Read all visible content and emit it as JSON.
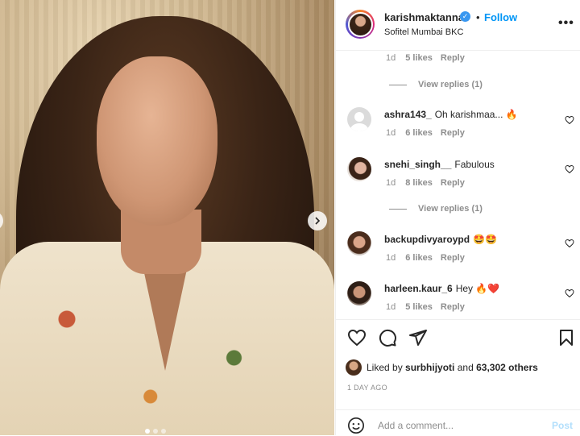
{
  "post": {
    "username": "karishmaktanna",
    "location": "Sofitel Mumbai BKC",
    "follow_label": "Follow",
    "dot_separator": "•",
    "more_label": "•••",
    "verified_mark": "✓"
  },
  "comments": {
    "top": {
      "time": "1d",
      "likes": "5 likes",
      "reply": "Reply"
    },
    "view_replies_1": "View replies (1)",
    "items": [
      {
        "username": "ashra143_",
        "text": "Oh karishmaa... 🔥",
        "time": "1d",
        "likes": "6 likes",
        "reply": "Reply"
      },
      {
        "username": "snehi_singh__",
        "text": "Fabulous",
        "time": "1d",
        "likes": "8 likes",
        "reply": "Reply"
      },
      {
        "username": "backupdivyaroypd",
        "text": "🤩🤩",
        "time": "1d",
        "likes": "6 likes",
        "reply": "Reply"
      },
      {
        "username": "harleen.kaur_6",
        "text": "Hey 🔥❤️",
        "time": "1d",
        "likes": "5 likes",
        "reply": "Reply"
      }
    ],
    "view_replies_2": "View replies (1)"
  },
  "likes": {
    "prefix": "Liked by",
    "user": "surbhijyoti",
    "middle": "and",
    "count": "63,302 others"
  },
  "time_ago": "1 DAY AGO",
  "comment_box": {
    "placeholder": "Add a comment...",
    "post_label": "Post"
  },
  "icons": [
    "heart-icon",
    "comment-icon",
    "share-icon",
    "bookmark-icon",
    "emoji-icon",
    "verified-icon",
    "chevron-right-icon"
  ],
  "colors": {
    "link": "#0095f6",
    "verified": "#3897f0",
    "muted": "#8e8e8e",
    "post_disabled": "#b2dffc"
  }
}
